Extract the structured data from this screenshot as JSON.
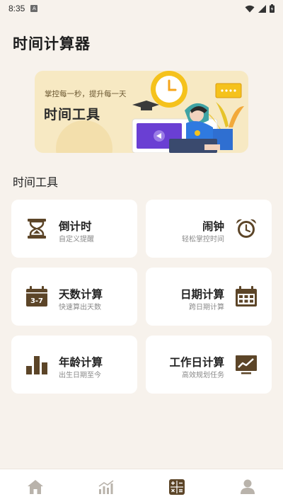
{
  "status": {
    "time": "8:35",
    "notif_badge": "A"
  },
  "header": {
    "title": "时间计算器"
  },
  "banner": {
    "slogan": "掌控每一秒，提升每一天",
    "title": "时间工具"
  },
  "section": {
    "title": "时间工具"
  },
  "tools": [
    {
      "title": "倒计时",
      "subtitle": "自定义提醒",
      "icon": "hourglass-icon"
    },
    {
      "title": "闹钟",
      "subtitle": "轻松掌控时间",
      "icon": "alarm-clock-icon"
    },
    {
      "title": "天数计算",
      "subtitle": "快速算出天数",
      "icon": "calendar-days-icon",
      "icon_text": "3-7"
    },
    {
      "title": "日期计算",
      "subtitle": "跨日期计算",
      "icon": "calendar-grid-icon"
    },
    {
      "title": "年龄计算",
      "subtitle": "出生日期至今",
      "icon": "bar-chart-icon"
    },
    {
      "title": "工作日计算",
      "subtitle": "高效规划任务",
      "icon": "trend-board-icon"
    }
  ],
  "nav": [
    {
      "name": "home-icon",
      "active": false
    },
    {
      "name": "stats-icon",
      "active": false
    },
    {
      "name": "calculator-icon",
      "active": true
    },
    {
      "name": "profile-icon",
      "active": false
    }
  ],
  "colors": {
    "accent": "#5c4528",
    "background": "#f7f2ec",
    "banner": "#f7e9c3",
    "inactive": "#b9b3ab"
  }
}
